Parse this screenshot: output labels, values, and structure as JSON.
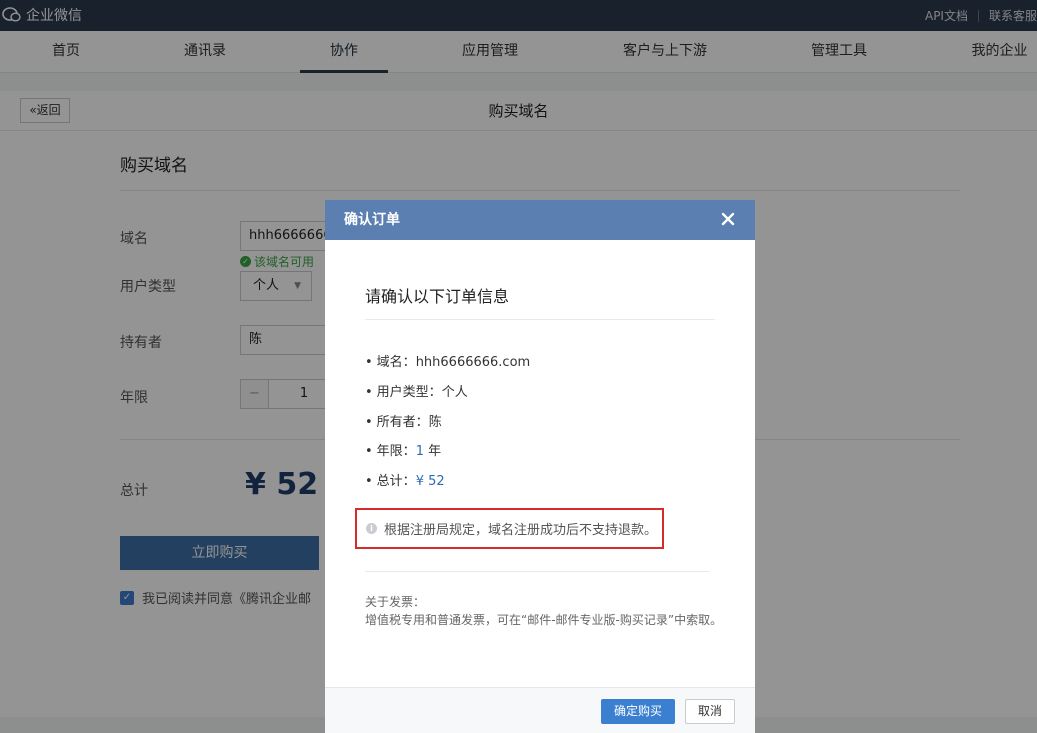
{
  "app": {
    "title": "企业微信"
  },
  "top_links": {
    "api_docs": "API文档",
    "support": "联系客服"
  },
  "nav": {
    "items": [
      "首页",
      "通讯录",
      "协作",
      "应用管理",
      "客户与上下游",
      "管理工具",
      "我的企业"
    ],
    "active": "协作"
  },
  "page": {
    "back_label": "«返回",
    "title": "购买域名"
  },
  "form": {
    "section_title": "购买域名",
    "domain_label": "域名",
    "domain_value": "hhh6666666",
    "domain_ok": "该域名可用",
    "user_type_label": "用户类型",
    "user_type_value": "个人",
    "holder_label": "持有者",
    "holder_value": "陈",
    "years_label": "年限",
    "years_minus": "−",
    "years_value": "1",
    "total_label": "总计",
    "total_value": "¥ 52",
    "buy_label": "立即购买",
    "agree_text": "我已阅读并同意《腾讯企业邮"
  },
  "modal": {
    "title": "确认订单",
    "heading": "请确认以下订单信息",
    "items": {
      "domain_label": "域名：",
      "domain_value": "hhh6666666.com",
      "user_type_label": "用户类型：",
      "user_type_value": "个人",
      "owner_label": "所有者：",
      "owner_value": "陈",
      "years_label": "年限：",
      "years_value": "1",
      "years_unit": "年",
      "total_label": "总计：",
      "total_value": "¥ 52"
    },
    "bullet": "•",
    "notice": "根据注册局规定，域名注册成功后不支持退款。",
    "invoice_title": "关于发票：",
    "invoice_text": "增值税专用和普通发票，可在“邮件-邮件专业版-购买记录”中索取。",
    "confirm_label": "确定购买",
    "cancel_label": "取消"
  },
  "colors": {
    "topbar": "#2c3a4e",
    "modal_header": "#5b7fb1",
    "highlight": "#2d6cb3",
    "notice_border": "#d52b2b",
    "confirm_button": "#3a7fd0",
    "success": "#3aa545"
  },
  "icons": {
    "logo": "chat-bubble-icon",
    "close": "close-icon",
    "check": "check-circle-icon",
    "info": "info-icon",
    "dropdown": "caret-down-icon"
  }
}
